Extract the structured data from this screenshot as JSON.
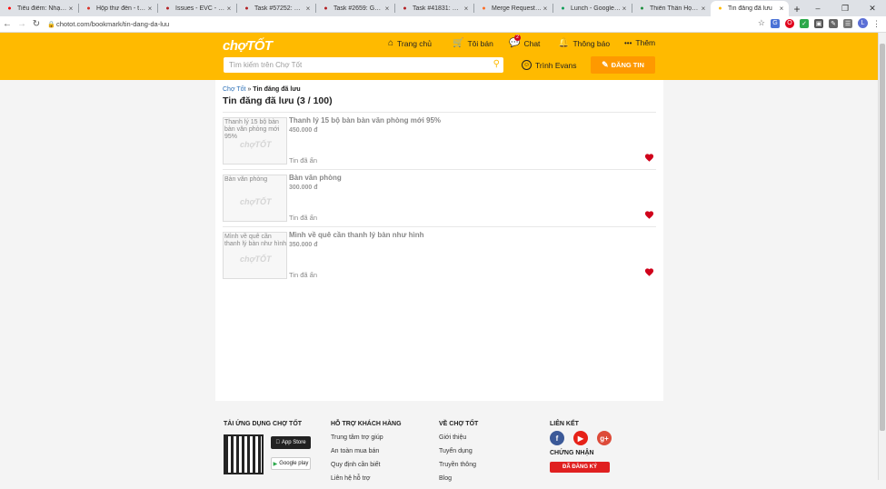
{
  "browser": {
    "tabs": [
      {
        "title": "Tiêu điểm: Nhạc nh",
        "icon": "youtube-icon",
        "color": "#ff0000"
      },
      {
        "title": "Hộp thư đến - trinh",
        "icon": "gmail-icon",
        "color": "#d93025"
      },
      {
        "title": "Issues - EVC - LIFET",
        "icon": "redmine-icon",
        "color": "#b32024"
      },
      {
        "title": "Task #57252: Mái b",
        "icon": "redmine-icon",
        "color": "#b32024"
      },
      {
        "title": "Task #2659: GĐ - H",
        "icon": "redmine-icon",
        "color": "#b32024"
      },
      {
        "title": "Task #41831: GĐ - H",
        "icon": "redmine-icon",
        "color": "#b32024"
      },
      {
        "title": "Merge Requests · E",
        "icon": "gitlab-icon",
        "color": "#fc6d26"
      },
      {
        "title": "Lunch - Google She",
        "icon": "sheets-icon",
        "color": "#0f9d58"
      },
      {
        "title": "Thiên Thần Học Việ",
        "icon": "sheet-icon",
        "color": "#1e8e3e"
      },
      {
        "title": "Tin đăng đã lưu",
        "icon": "chotot-icon",
        "color": "#ffba00",
        "active": true
      }
    ],
    "url": "chotot.com/bookmark/tin-dang-da-luu"
  },
  "header": {
    "logo": "chợTỐT",
    "menu": {
      "home": "Trang chủ",
      "myads": "Tôi bán",
      "chat": "Chat",
      "chat_badge": "2",
      "notify": "Thông báo",
      "more": "Thêm"
    },
    "search_placeholder": "Tìm kiếm trên Chợ Tốt",
    "user": "Trình Evans",
    "post_button": "ĐĂNG TIN",
    "accent": "#ffba00"
  },
  "main": {
    "breadcrumb_home": "Chợ Tốt",
    "breadcrumb_sep": "»",
    "breadcrumb_current": "Tin đăng đã lưu",
    "title": "Tin đăng đã lưu (3 / 100)",
    "items": [
      {
        "thumb_alt": "Thanh lý 15 bộ bàn bàn văn phòng mới 95%",
        "title": "Thanh lý 15 bộ bàn bàn văn phòng mới 95%",
        "price": "450.000 đ",
        "status": "Tin đã ẩn"
      },
      {
        "thumb_alt": "Bàn văn phòng",
        "title": "Bàn văn phòng",
        "price": "300.000 đ",
        "status": "Tin đã ẩn"
      },
      {
        "thumb_alt": "Mình về quê cần thanh lý bàn như hình",
        "title": "Mình về quê cần thanh lý bàn như hình",
        "price": "350.000 đ",
        "status": "Tin đã ẩn"
      }
    ],
    "watermark": "chợTỐT",
    "heart_color": "#d0021b"
  },
  "footer": {
    "app": {
      "heading": "TẢI ỨNG DỤNG CHỢ TỐT",
      "appstore": "App Store",
      "googleplay": "Google play"
    },
    "support": {
      "heading": "HỖ TRỢ KHÁCH HÀNG",
      "links": [
        "Trung tâm trợ giúp",
        "An toàn mua bán",
        "Quy định cần biết",
        "Liên hệ hỗ trợ"
      ]
    },
    "about": {
      "heading": "VỀ CHỢ TỐT",
      "links": [
        "Giới thiệu",
        "Tuyển dụng",
        "Truyền thông",
        "Blog"
      ]
    },
    "links": {
      "heading": "LIÊN KẾT",
      "cert_heading": "CHỨNG NHẬN",
      "cert_badge": "ĐÃ ĐĂNG KÝ"
    }
  }
}
